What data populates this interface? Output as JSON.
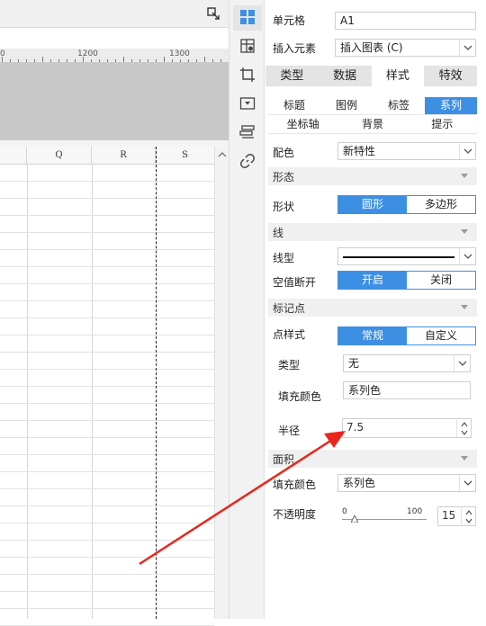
{
  "ruler": {
    "mark_1": "1200",
    "mark_2": "1300"
  },
  "columns": [
    "Q",
    "R",
    "S"
  ],
  "panel": {
    "cell_label": "单元格",
    "cell_value": "A1",
    "insert_label": "插入元素",
    "insert_value": "插入图表 (C)",
    "main_tabs": [
      "类型",
      "数据",
      "样式",
      "特效"
    ],
    "main_tab_active": "样式",
    "sub_tabs_row1": [
      "标题",
      "图例",
      "标签",
      "系列"
    ],
    "sub_tabs_row2": [
      "坐标轴",
      "背景",
      "提示"
    ],
    "sub_tab_active": "系列",
    "color_label": "配色",
    "color_value": "新特性",
    "section_form": "形态",
    "shape_label": "形状",
    "shape_options": [
      "圆形",
      "多边形"
    ],
    "shape_selected": "圆形",
    "section_line": "线",
    "line_type_label": "线型",
    "null_break_label": "空值断开",
    "null_break_options": [
      "开启",
      "关闭"
    ],
    "null_break_selected": "开启",
    "section_marker": "标记点",
    "point_style_label": "点样式",
    "point_style_options": [
      "常规",
      "自定义"
    ],
    "point_style_selected": "常规",
    "type_label": "类型",
    "type_value": "无",
    "fill_color_label": "填充颜色",
    "fill_color_value": "系列色",
    "radius_label": "半径",
    "radius_value": "7.5",
    "section_area": "面积",
    "area_fill_label": "填充颜色",
    "area_fill_value": "系列色",
    "opacity_label": "不透明度",
    "opacity_min": "0",
    "opacity_max": "100",
    "opacity_value": "15"
  },
  "colors": {
    "accent": "#3d8fe3",
    "annotation_arrow": "#e8261c"
  }
}
